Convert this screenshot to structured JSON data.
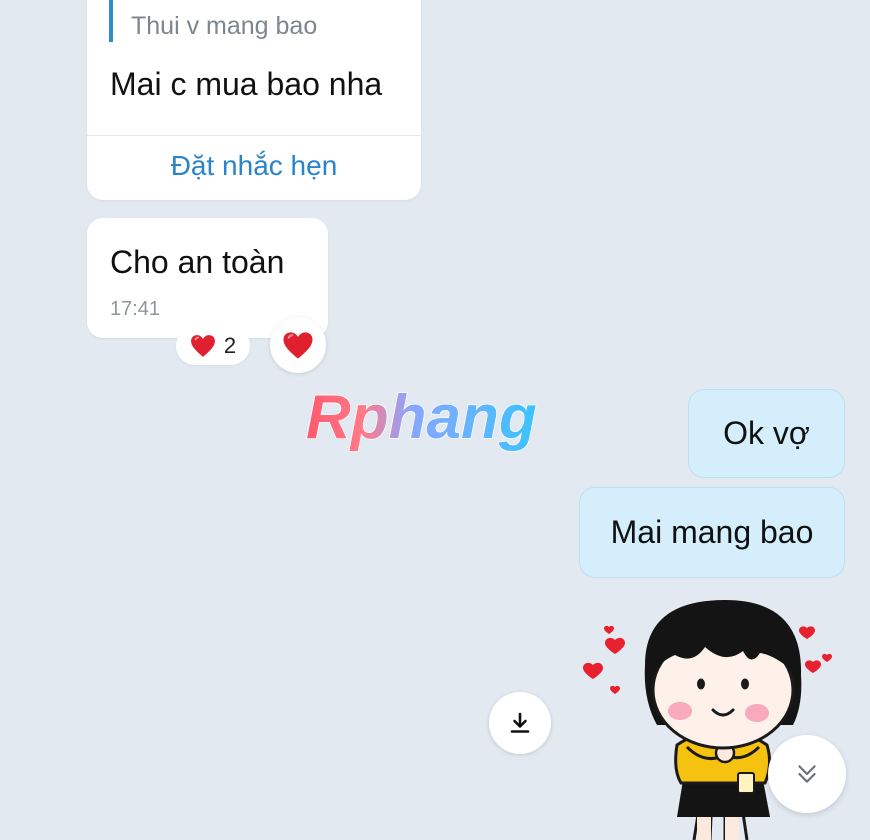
{
  "reply_card": {
    "quoted_text": "Thui v mang bao",
    "message": "Mai c mua bao nha",
    "action_label": "Đặt nhắc hẹn"
  },
  "incoming_message": {
    "text": "Cho an toàn",
    "time": "17:41",
    "reaction": {
      "icon": "heart-icon",
      "count": "2"
    }
  },
  "watermark": {
    "text": "Rphang"
  },
  "outgoing_messages": [
    {
      "text": "Ok vợ"
    },
    {
      "text": "Mai mang bao"
    }
  ],
  "sticker": {
    "icon": "girl-with-hearts-sticker"
  },
  "buttons": {
    "download_icon": "download-icon",
    "scroll_icon": "chevron-double-down-icon"
  },
  "colors": {
    "background": "#e3e9f1",
    "incoming_bubble": "#ffffff",
    "outgoing_bubble": "#d4eefb",
    "accent_blue": "#2a84c9",
    "heart_red": "#e0202f"
  }
}
